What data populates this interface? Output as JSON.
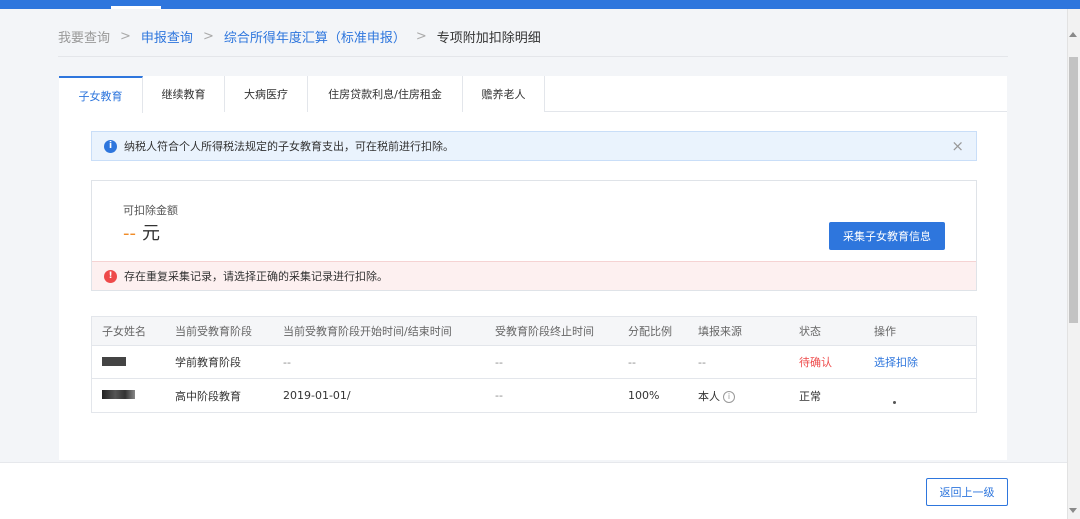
{
  "breadcrumb": {
    "items": [
      "我要查询",
      "申报查询",
      "综合所得年度汇算（标准申报）",
      "专项附加扣除明细"
    ],
    "separator": ">"
  },
  "tabs": [
    "子女教育",
    "继续教育",
    "大病医疗",
    "住房贷款利息/住房租金",
    "赡养老人"
  ],
  "active_tab": "子女教育",
  "info_bar": {
    "text": "纳税人符合个人所得税法规定的子女教育支出，可在税前进行扣除。",
    "close": "×"
  },
  "amount": {
    "label": "可扣除金额",
    "value": "--",
    "unit": "元"
  },
  "collect_button": "采集子女教育信息",
  "warning": {
    "text": "存在重复采集记录，请选择正确的采集记录进行扣除。"
  },
  "table": {
    "headers": [
      "子女姓名",
      "当前受教育阶段",
      "当前受教育阶段开始时间/结束时间",
      "受教育阶段终止时间",
      "分配比例",
      "填报来源",
      "状态",
      "操作"
    ],
    "rows": [
      {
        "stage": "学前教育阶段",
        "start_end": "--",
        "end": "--",
        "ratio": "--",
        "source": "--",
        "status": "待确认",
        "action": "选择扣除"
      },
      {
        "stage": "高中阶段教育",
        "start_end": "2019-01-01/",
        "end": "--",
        "ratio": "100%",
        "source": "本人",
        "status": "正常",
        "action": ""
      }
    ]
  },
  "footer": {
    "back_button": "返回上一级"
  },
  "colors": {
    "primary": "#2e76dd",
    "danger": "#ee4a4a",
    "accent_orange": "#f08c28"
  }
}
